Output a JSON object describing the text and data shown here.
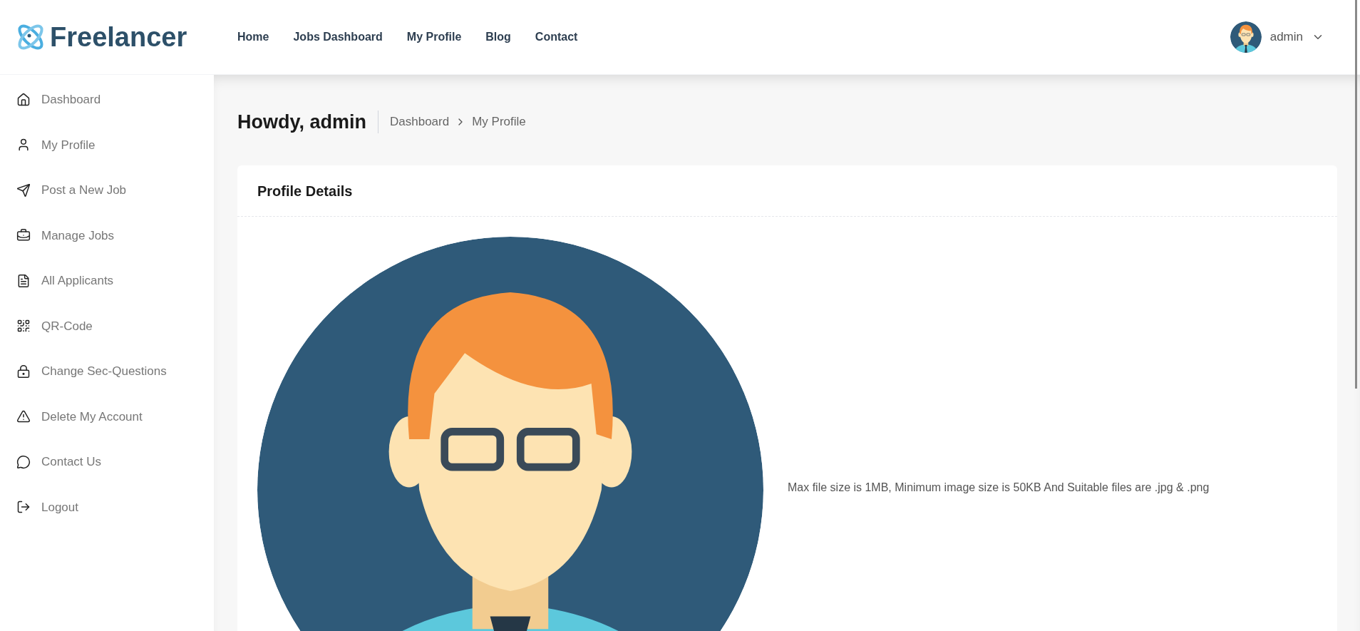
{
  "brand": {
    "name": "Freelancer"
  },
  "nav": [
    "Home",
    "Jobs Dashboard",
    "My Profile",
    "Blog",
    "Contact"
  ],
  "user": {
    "name": "admin"
  },
  "sidebar": {
    "items": [
      {
        "label": "Dashboard",
        "kind": "home"
      },
      {
        "label": "My Profile",
        "kind": "user"
      },
      {
        "label": "Post a New Job",
        "kind": "send"
      },
      {
        "label": "Manage Jobs",
        "kind": "briefcase"
      },
      {
        "label": "All Applicants",
        "kind": "document"
      },
      {
        "label": "QR-Code",
        "kind": "qr"
      },
      {
        "label": "Change Sec-Questions",
        "kind": "lock"
      },
      {
        "label": "Delete My Account",
        "kind": "warning"
      },
      {
        "label": "Contact Us",
        "kind": "chat"
      },
      {
        "label": "Logout",
        "kind": "logout"
      }
    ]
  },
  "page": {
    "greeting": "Howdy, admin",
    "breadcrumb": [
      "Dashboard",
      "My Profile"
    ]
  },
  "card": {
    "title": "Profile Details",
    "upload_hint": "Max file size is 1MB, Minimum image size is 50KB And Suitable files are .jpg & .png"
  }
}
